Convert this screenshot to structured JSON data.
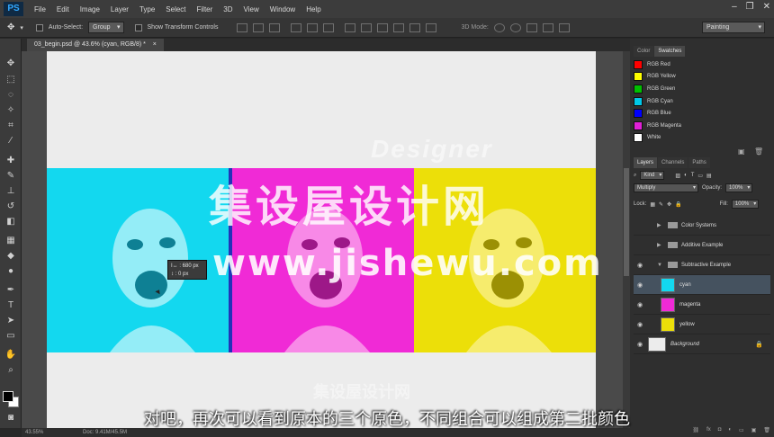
{
  "menubar": {
    "logo": "PS",
    "items": [
      "File",
      "Edit",
      "Image",
      "Layer",
      "Type",
      "Select",
      "Filter",
      "3D",
      "View",
      "Window",
      "Help"
    ]
  },
  "options": {
    "auto_select_label": "Auto-Select:",
    "auto_select_value": "Group",
    "show_transform_label": "Show Transform Controls",
    "mode_3d_label": "3D Mode:",
    "workspace": "Painting"
  },
  "document": {
    "tab_title": "03_begin.psd @ 43.6% (cyan, RGB/8) *",
    "tooltip_w": "680 px",
    "tooltip_h": "0 px"
  },
  "status": {
    "zoom": "43.55%",
    "doc": "Doc: 9.41M/45.5M"
  },
  "watermark": {
    "designer": "Designer",
    "cn": "集设屋设计网",
    "url": "www.jishewu.com",
    "small": "集设屋设计网"
  },
  "subtitle": "对吧，再次可以看到原本的三个原色，不同组合可以组成第二批颜色",
  "swatch_panel": {
    "tabs": [
      "Color",
      "Swatches"
    ],
    "items": [
      {
        "label": "RGB Red",
        "color": "#ff0000"
      },
      {
        "label": "RGB Yellow",
        "color": "#ffff00"
      },
      {
        "label": "RGB Green",
        "color": "#00c000"
      },
      {
        "label": "RGB Cyan",
        "color": "#00c8e8"
      },
      {
        "label": "RGB Blue",
        "color": "#0000ff"
      },
      {
        "label": "RGB Magenta",
        "color": "#e020d8"
      },
      {
        "label": "White",
        "color": "#ffffff"
      }
    ]
  },
  "layers_panel": {
    "tabs": [
      "Layers",
      "Channels",
      "Paths"
    ],
    "kind": "Kind",
    "blend_mode": "Multiply",
    "opacity_label": "Opacity:",
    "opacity_value": "100%",
    "lock_label": "Lock:",
    "fill_label": "Fill:",
    "fill_value": "100%",
    "layers": [
      {
        "name": "Color Systems",
        "type": "folder",
        "visible": false
      },
      {
        "name": "Additive Example",
        "type": "folder",
        "visible": false
      },
      {
        "name": "Subtractive Example",
        "type": "folder-open",
        "visible": true
      },
      {
        "name": "cyan",
        "type": "layer",
        "visible": true,
        "selected": true,
        "thumb": "#13d8ef"
      },
      {
        "name": "magenta",
        "type": "layer",
        "visible": true,
        "thumb": "#f02ad6"
      },
      {
        "name": "yellow",
        "type": "layer",
        "visible": true,
        "thumb": "#ecdf09"
      },
      {
        "name": "Background",
        "type": "background",
        "visible": true,
        "thumb": "#ececec"
      }
    ]
  },
  "colors": {
    "cyan": "#13d8ef",
    "magenta": "#f02ad6",
    "yellow": "#ecdf09"
  }
}
